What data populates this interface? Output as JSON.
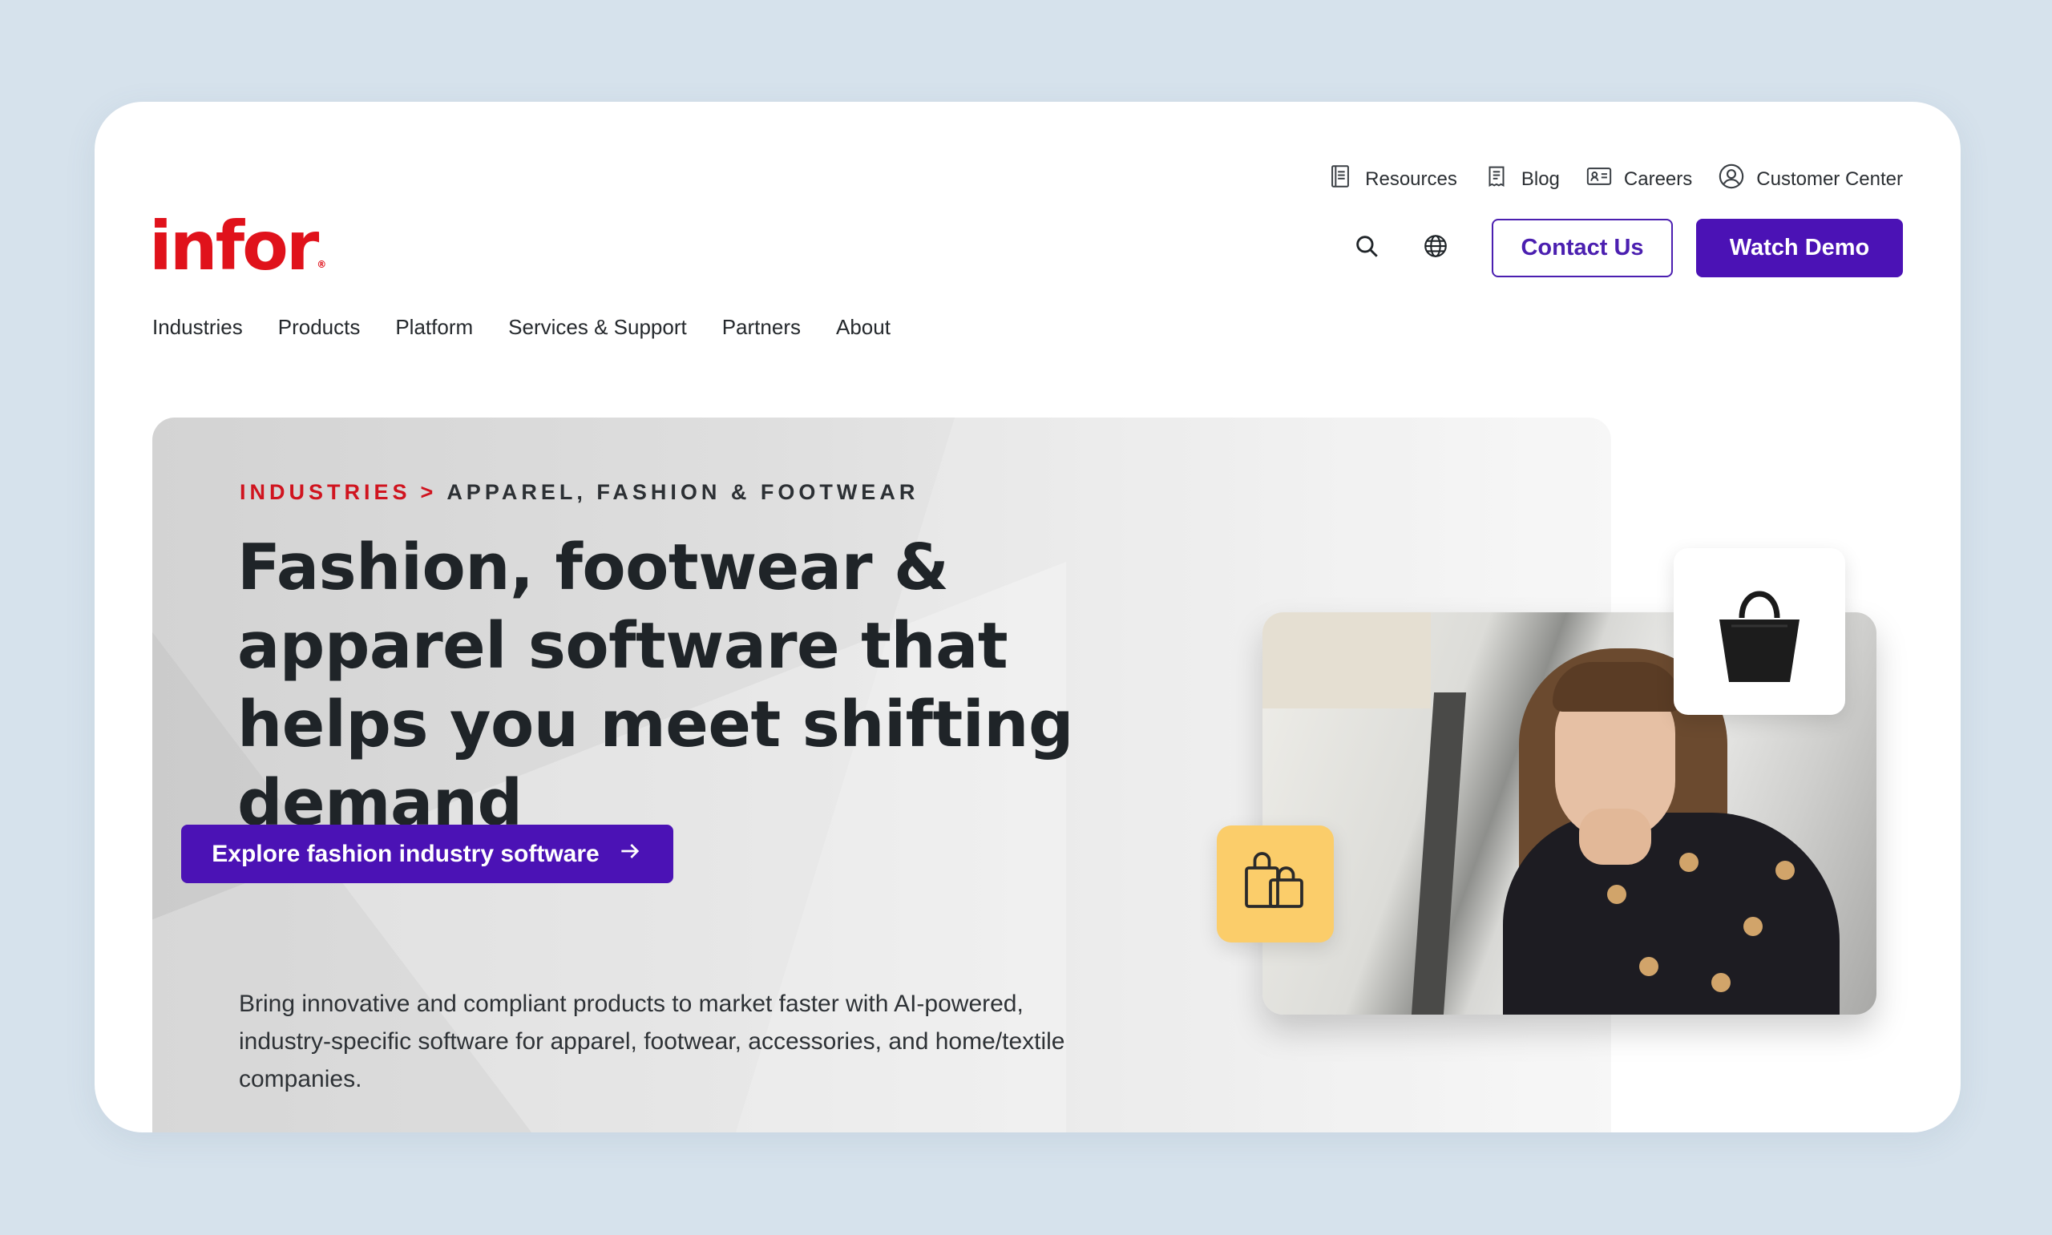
{
  "utility_nav": {
    "resources": "Resources",
    "blog": "Blog",
    "careers": "Careers",
    "customer_center": "Customer Center"
  },
  "brand": {
    "logo_text": "infor",
    "logo_mark": "®",
    "color": "#e0121b"
  },
  "header": {
    "search_icon": "search-icon",
    "globe_icon": "globe-icon",
    "contact_label": "Contact Us",
    "demo_label": "Watch Demo",
    "accent": "#4b12b5"
  },
  "main_nav": [
    {
      "label": "Industries"
    },
    {
      "label": "Products"
    },
    {
      "label": "Platform"
    },
    {
      "label": "Services & Support"
    },
    {
      "label": "Partners"
    },
    {
      "label": "About"
    }
  ],
  "hero": {
    "breadcrumb": {
      "parent": "INDUSTRIES",
      "separator": ">",
      "current": "APPAREL, FASHION & FOOTWEAR"
    },
    "title_lines": [
      "Fashion, footwear &",
      "apparel software that",
      "helps you meet shifting",
      "demand"
    ],
    "description_lines": [
      "Bring innovative and compliant products to market faster with AI-powered,",
      "industry-specific software for apparel, footwear, accessories, and home/textile",
      "companies."
    ],
    "cta_label": "Explore fashion industry software"
  }
}
